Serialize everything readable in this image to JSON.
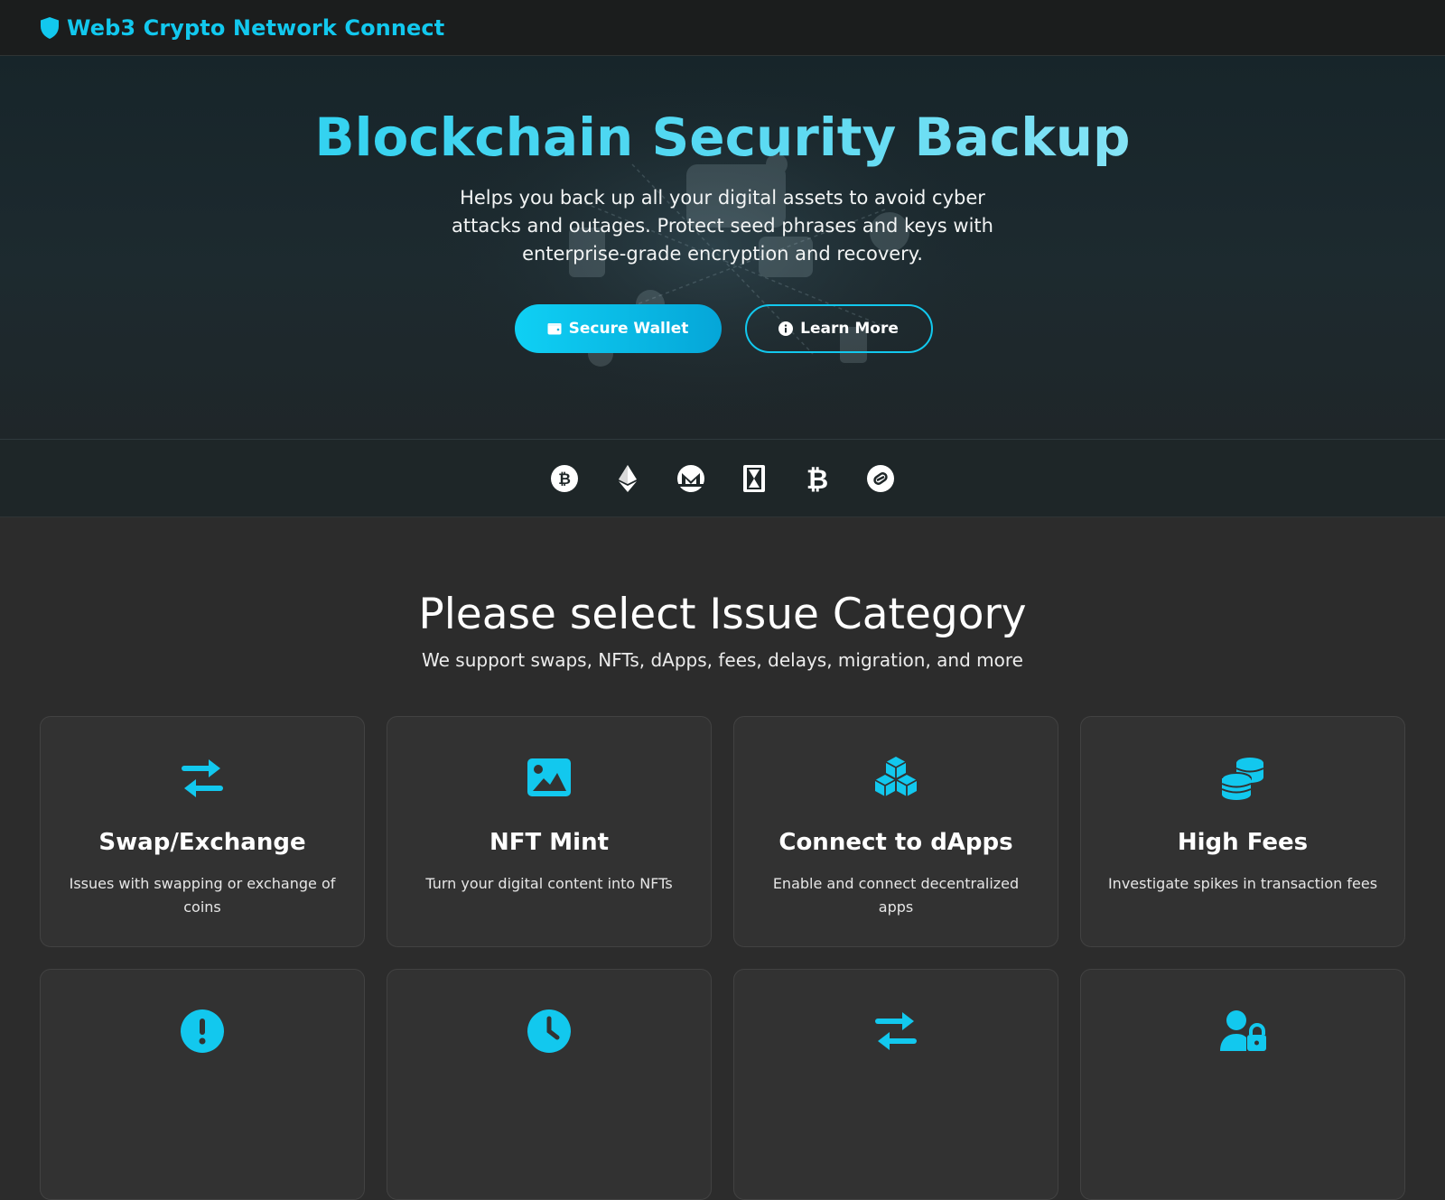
{
  "navbar": {
    "brand_icon": "shield-icon",
    "brand": "Web3 Crypto Network Connect"
  },
  "hero": {
    "title": "Blockchain Security Backup",
    "description": "Helps you back up all your digital assets to avoid cyber attacks and outages. Protect seed phrases and keys with enterprise-grade encryption and recovery.",
    "primary_button": {
      "label": "Secure Wallet",
      "icon": "wallet-icon"
    },
    "secondary_button": {
      "label": "Learn More",
      "icon": "info-circle-icon"
    }
  },
  "coins": [
    "bitcoin-icon",
    "ethereum-icon",
    "monero-icon",
    "hourglass-token-icon",
    "bitcoin-b-icon",
    "chainlink-icon"
  ],
  "issues": {
    "title": "Please select Issue Category",
    "subtitle": "We support swaps, NFTs, dApps, fees, delays, migration, and more",
    "cards": [
      {
        "icon": "swap-arrows-icon",
        "title": "Swap/Exchange",
        "description": "Issues with swapping or exchange of coins"
      },
      {
        "icon": "image-icon",
        "title": "NFT Mint",
        "description": "Turn your digital content into NFTs"
      },
      {
        "icon": "cubes-icon",
        "title": "Connect to dApps",
        "description": "Enable and connect decentralized apps"
      },
      {
        "icon": "coins-icon",
        "title": "High Fees",
        "description": "Investigate spikes in transaction fees"
      },
      {
        "icon": "exclamation-circle-icon",
        "title": "",
        "description": ""
      },
      {
        "icon": "clock-icon",
        "title": "",
        "description": ""
      },
      {
        "icon": "swap-arrows-icon",
        "title": "",
        "description": ""
      },
      {
        "icon": "user-lock-icon",
        "title": "",
        "description": ""
      }
    ]
  },
  "colors": {
    "accent": "#12c8ee",
    "page_bg": "#2c2c2c",
    "card_bg": "#323232",
    "navbar_bg": "#1b1d1d"
  }
}
